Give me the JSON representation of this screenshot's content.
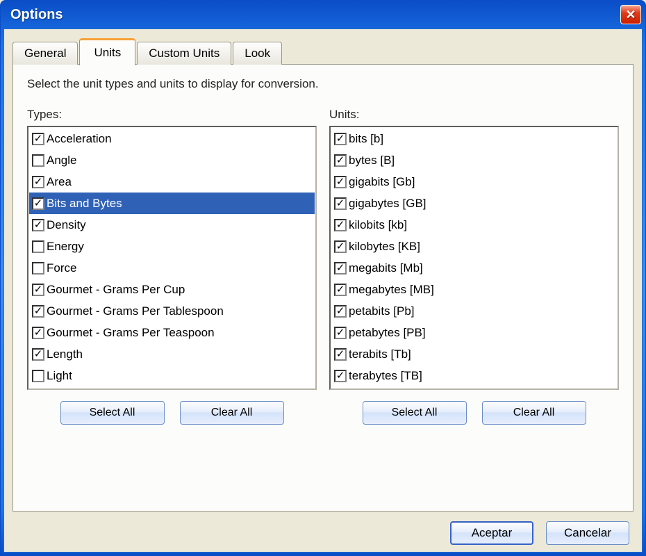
{
  "window": {
    "title": "Options",
    "close_glyph": "✕"
  },
  "tabs": [
    {
      "label": "General",
      "active": false
    },
    {
      "label": "Units",
      "active": true
    },
    {
      "label": "Custom Units",
      "active": false
    },
    {
      "label": "Look",
      "active": false
    }
  ],
  "instruction": "Select the unit types and units to display for conversion.",
  "types": {
    "label": "Types:",
    "items": [
      {
        "label": "Acceleration",
        "checked": true,
        "selected": false
      },
      {
        "label": "Angle",
        "checked": false,
        "selected": false
      },
      {
        "label": "Area",
        "checked": true,
        "selected": false
      },
      {
        "label": "Bits and Bytes",
        "checked": true,
        "selected": true
      },
      {
        "label": "Density",
        "checked": true,
        "selected": false
      },
      {
        "label": "Energy",
        "checked": false,
        "selected": false
      },
      {
        "label": "Force",
        "checked": false,
        "selected": false
      },
      {
        "label": "Gourmet - Grams Per Cup",
        "checked": true,
        "selected": false
      },
      {
        "label": "Gourmet - Grams Per Tablespoon",
        "checked": true,
        "selected": false
      },
      {
        "label": "Gourmet - Grams Per Teaspoon",
        "checked": true,
        "selected": false
      },
      {
        "label": "Length",
        "checked": true,
        "selected": false
      },
      {
        "label": "Light",
        "checked": false,
        "selected": false
      }
    ],
    "select_all": "Select All",
    "clear_all": "Clear All"
  },
  "units": {
    "label": "Units:",
    "items": [
      {
        "label": "bits [b]",
        "checked": true
      },
      {
        "label": "bytes [B]",
        "checked": true
      },
      {
        "label": "gigabits [Gb]",
        "checked": true
      },
      {
        "label": "gigabytes [GB]",
        "checked": true
      },
      {
        "label": "kilobits [kb]",
        "checked": true
      },
      {
        "label": "kilobytes [KB]",
        "checked": true
      },
      {
        "label": "megabits [Mb]",
        "checked": true
      },
      {
        "label": "megabytes [MB]",
        "checked": true
      },
      {
        "label": "petabits [Pb]",
        "checked": true
      },
      {
        "label": "petabytes [PB]",
        "checked": true
      },
      {
        "label": "terabits [Tb]",
        "checked": true
      },
      {
        "label": "terabytes [TB]",
        "checked": true
      }
    ],
    "select_all": "Select All",
    "clear_all": "Clear All"
  },
  "dialog_buttons": {
    "accept": "Aceptar",
    "cancel": "Cancelar"
  },
  "glyphs": {
    "check": "✓"
  }
}
